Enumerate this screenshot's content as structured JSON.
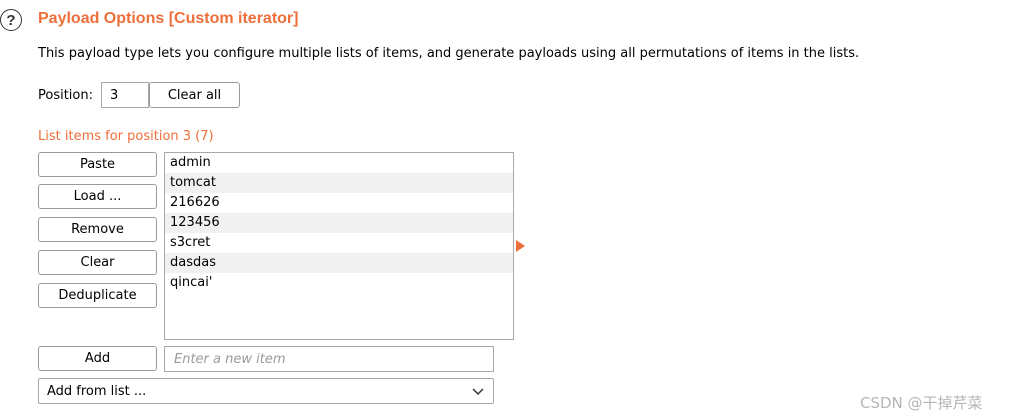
{
  "header": {
    "help_icon": "question-circle-icon",
    "title": "Payload Options [Custom iterator]",
    "title_color": "#ee6f3a"
  },
  "description": "This payload type lets you configure multiple lists of items, and generate payloads using all permutations of items in the lists.",
  "position": {
    "label": "Position:",
    "value": "3",
    "clear_all_label": "Clear all"
  },
  "list": {
    "heading": "List items for position 3 (7)",
    "buttons": {
      "paste": "Paste",
      "load": "Load ...",
      "remove": "Remove",
      "clear": "Clear",
      "deduplicate": "Deduplicate"
    },
    "items": [
      "admin",
      "tomcat",
      "216626",
      "123456",
      "s3cret",
      "dasdas",
      "qincai'"
    ]
  },
  "add": {
    "button_label": "Add",
    "input_placeholder": "Enter a new item",
    "input_value": ""
  },
  "add_from_list": {
    "selected": "Add from list ..."
  },
  "watermark": "CSDN @干掉芹菜"
}
